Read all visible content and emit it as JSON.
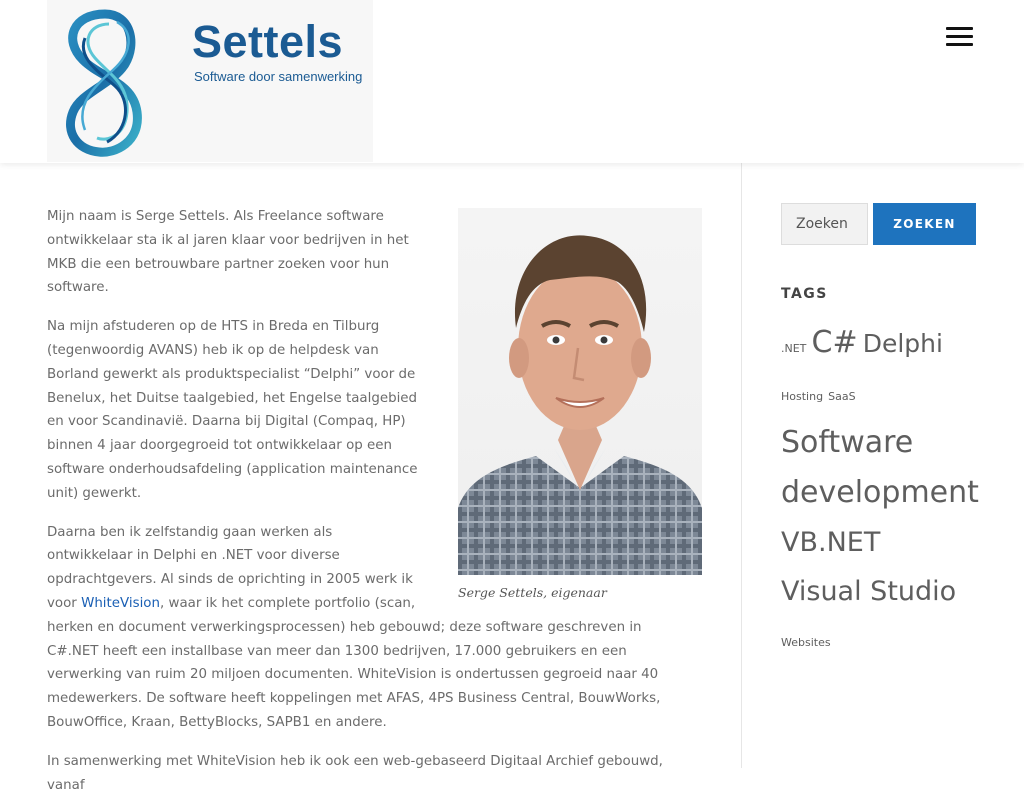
{
  "header": {
    "logo_name": "Settels",
    "logo_tagline": "Software door samenwerking",
    "menu_icon": "hamburger-menu-icon"
  },
  "colors": {
    "accent": "#1e73be",
    "logo_blue": "#1b5b93",
    "link": "#1a5fb4"
  },
  "article": {
    "photo_caption": "Serge Settels, eigenaar",
    "p1": "Mijn naam is Serge Settels. Als Freelance software ontwikkelaar sta ik al jaren klaar voor bedrijven in het MKB die een betrouwbare partner zoeken voor hun software.",
    "p2": "Na mijn afstuderen op de HTS in Breda en Tilburg (tegenwoordig AVANS) heb ik op de helpdesk van Borland gewerkt als produktspecialist “Delphi” voor de Benelux, het Duitse taalgebied, het Engelse taalgebied en voor Scandinavië. Daarna bij Digital (Compaq, HP) binnen 4 jaar doorgegroeid tot ontwikkelaar op een software onderhoudsafdeling (application maintenance unit) gewerkt.",
    "p3_before": "Daarna ben ik zelfstandig gaan werken als ontwikkelaar in Delphi en .NET voor diverse opdrachtgevers. Al sinds de oprichting in 2005 werk ik voor ",
    "p3_link": "WhiteVision",
    "p3_after": ", waar ik het complete portfolio (scan, herken en document verwerkingsprocessen) heb gebouwd; deze software geschreven in C#.NET heeft een installbase van meer dan 1300 bedrijven, 17.000 gebruikers en een verwerking van ruim 20 miljoen documenten. WhiteVision is ondertussen gegroeid naar 40 medewerkers. De software heeft koppelingen met AFAS, 4PS Business Central, BouwWorks, BouwOffice, Kraan, BettyBlocks, SAPB1 en andere.",
    "p4": "In samenwerking met WhiteVision heb ik ook een web-gebaseerd Digitaal Archief gebouwd, vanaf"
  },
  "sidebar": {
    "search_placeholder": "Zoeken",
    "search_button": "ZOEKEN",
    "tags_title": "TAGS",
    "tags": [
      {
        "label": ".NET",
        "size": 11
      },
      {
        "label": "C#",
        "size": 30
      },
      {
        "label": "Delphi",
        "size": 25
      },
      {
        "label": "Hosting",
        "size": 11
      },
      {
        "label": "SaaS",
        "size": 11
      },
      {
        "label": "Software development",
        "size": 30
      },
      {
        "label": "VB.NET",
        "size": 27
      },
      {
        "label": "Visual Studio",
        "size": 27
      },
      {
        "label": "Websites",
        "size": 11
      }
    ]
  }
}
